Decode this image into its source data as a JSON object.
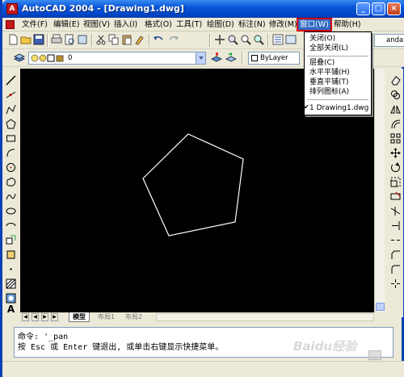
{
  "window": {
    "title": "AutoCAD 2004 - [Drawing1.dwg]",
    "app_icon_glyph": "A",
    "minimize_glyph": "_",
    "maximize_glyph": "□",
    "close_glyph": "×"
  },
  "menubar": {
    "items": [
      {
        "label": "文件(F)"
      },
      {
        "label": "编辑(E)"
      },
      {
        "label": "视图(V)"
      },
      {
        "label": "插入(I)"
      },
      {
        "label": "格式(O)"
      },
      {
        "label": "工具(T)"
      },
      {
        "label": "绘图(D)"
      },
      {
        "label": "标注(N)"
      },
      {
        "label": "修改(M)"
      },
      {
        "label": "窗口(W)"
      },
      {
        "label": "帮助(H)"
      }
    ],
    "active_index": 9
  },
  "window_menu": {
    "items": [
      {
        "label": "关闭(O)"
      },
      {
        "label": "全部关闭(L)"
      },
      {
        "label": "层叠(C)"
      },
      {
        "label": "水平平铺(H)"
      },
      {
        "label": "垂直平铺(T)"
      },
      {
        "label": "排列图标(A)"
      },
      {
        "label": "1 Drawing1.dwg",
        "checked": true
      }
    ]
  },
  "toolbar": {
    "layer_value": "0",
    "linetype_value": "ByLayer",
    "dimstyle_value": "andard"
  },
  "layout_tabs": [
    {
      "label": "模型",
      "active": true
    },
    {
      "label": "布局1",
      "active": false
    },
    {
      "label": "布局2",
      "active": false
    }
  ],
  "command": {
    "line1": "命令: '_pan",
    "line2": "按 Esc 或 Enter 键退出, 或单击右键显示快捷菜单。"
  },
  "watermark": "Baidu经验",
  "colors": {
    "canvas": "#000000",
    "pentagon": "#ffffff",
    "menu_highlight": "#316ac5",
    "menu_outline": "#d40000"
  }
}
